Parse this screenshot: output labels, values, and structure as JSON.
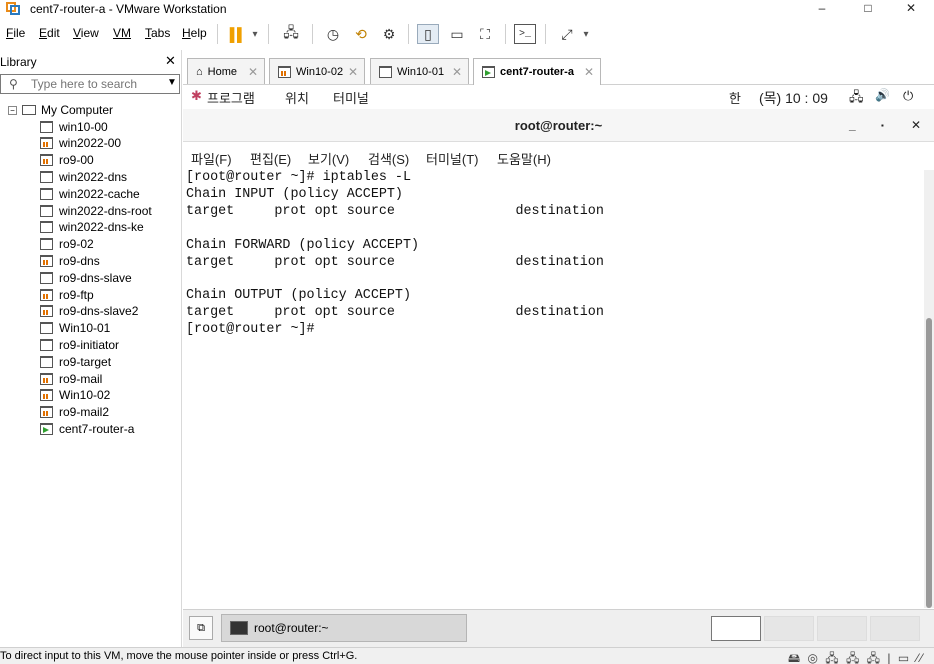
{
  "window": {
    "title": "cent7-router-a - VMware Workstation",
    "minimize": "–",
    "maximize": "□",
    "close": "✕"
  },
  "menu": {
    "items": [
      {
        "label": "File",
        "u": "F",
        "rest": "ile"
      },
      {
        "label": "Edit",
        "u": "E",
        "rest": "dit"
      },
      {
        "label": "View",
        "u": "V",
        "rest": "iew"
      },
      {
        "label": "VM",
        "u": "VM",
        "rest": ""
      },
      {
        "label": "Tabs",
        "u": "T",
        "rest": "abs"
      },
      {
        "label": "Help",
        "u": "H",
        "rest": "elp"
      }
    ]
  },
  "toolbar": {
    "pause": "▌▌",
    "pause_drop": "▾",
    "send_keys": "🖧",
    "snapshot": "◷",
    "revert": "⟲",
    "manage": "⚙",
    "view_single": "▯",
    "view_bar": "▭",
    "fullscreen": "⛶",
    "console": ">_",
    "stretch": "⤢",
    "stretch_drop": "▾"
  },
  "library": {
    "title": "Library",
    "close": "✕",
    "search_placeholder": "Type here to search",
    "root": "My Computer",
    "vms": [
      {
        "name": "win10-00",
        "state": "off"
      },
      {
        "name": "win2022-00",
        "state": "running"
      },
      {
        "name": "ro9-00",
        "state": "running"
      },
      {
        "name": "win2022-dns",
        "state": "off"
      },
      {
        "name": "win2022-cache",
        "state": "off"
      },
      {
        "name": "win2022-dns-root",
        "state": "off"
      },
      {
        "name": "win2022-dns-ke",
        "state": "off"
      },
      {
        "name": "ro9-02",
        "state": "off"
      },
      {
        "name": "ro9-dns",
        "state": "running"
      },
      {
        "name": "ro9-dns-slave",
        "state": "off"
      },
      {
        "name": "ro9-ftp",
        "state": "running"
      },
      {
        "name": "ro9-dns-slave2",
        "state": "running"
      },
      {
        "name": "Win10-01",
        "state": "off"
      },
      {
        "name": "ro9-initiator",
        "state": "off"
      },
      {
        "name": "ro9-target",
        "state": "off"
      },
      {
        "name": "ro9-mail",
        "state": "running"
      },
      {
        "name": "Win10-02",
        "state": "running"
      },
      {
        "name": "ro9-mail2",
        "state": "running"
      },
      {
        "name": "cent7-router-a",
        "state": "active"
      }
    ]
  },
  "tabs": [
    {
      "label": "Home",
      "icon": "⌂"
    },
    {
      "label": "Win10-02"
    },
    {
      "label": "Win10-01"
    },
    {
      "label": "cent7-router-a"
    }
  ],
  "gnome": {
    "apps": "프로그램",
    "places": "위치",
    "terminal": "터미널",
    "ime": "한",
    "clock": "(목) 10 : 09",
    "network": "🖧",
    "volume": "🔊",
    "power": "⏻"
  },
  "terminal": {
    "title": "root@router:~",
    "min": "_",
    "max": "▪",
    "close": "✕",
    "menus": [
      "파일(F)",
      "편집(E)",
      "보기(V)",
      "검색(S)",
      "터미널(T)",
      "도움말(H)"
    ],
    "output": "[root@router ~]# iptables -L\nChain INPUT (policy ACCEPT)\ntarget     prot opt source               destination\n\nChain FORWARD (policy ACCEPT)\ntarget     prot opt source               destination\n\nChain OUTPUT (policy ACCEPT)\ntarget     prot opt source               destination\n[root@router ~]#"
  },
  "taskbar": {
    "task_label": "root@router:~"
  },
  "statusbar": {
    "message": "To direct input to this VM, move the mouse pointer inside or press Ctrl+G.",
    "icons": "🖴 ◎ 🖧 🖧 🖧 | ▭ ⁄⁄"
  }
}
